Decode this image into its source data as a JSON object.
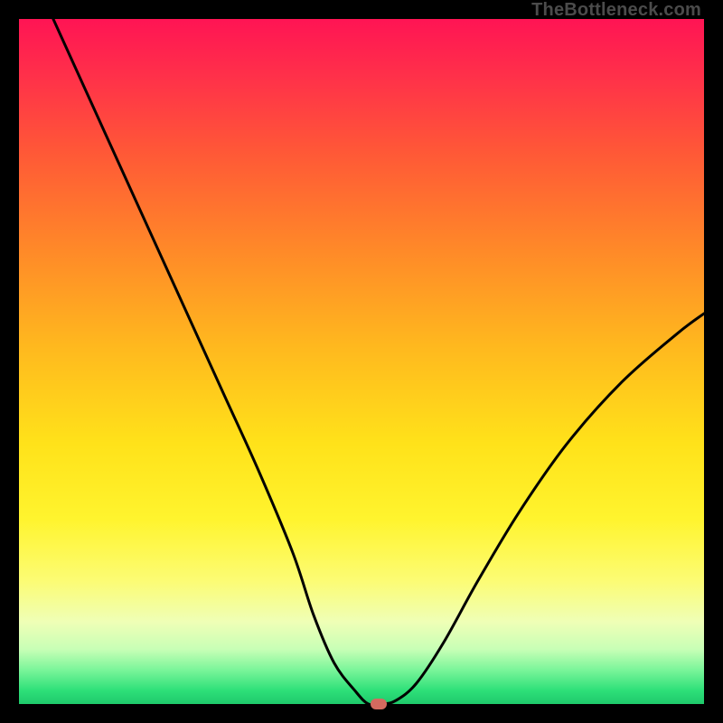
{
  "watermark": {
    "text": "TheBottleneck.com"
  },
  "chart_data": {
    "type": "line",
    "title": "",
    "xlabel": "",
    "ylabel": "",
    "xlim": [
      0,
      100
    ],
    "ylim": [
      0,
      100
    ],
    "grid": false,
    "legend": false,
    "series": [
      {
        "name": "bottleneck-curve",
        "x": [
          5,
          10,
          15,
          20,
          25,
          30,
          35,
          40,
          43,
          46,
          49,
          51,
          53,
          55,
          58,
          62,
          67,
          73,
          80,
          88,
          96,
          100
        ],
        "y": [
          100,
          89,
          78,
          67,
          56,
          45,
          34,
          22,
          13,
          6,
          2,
          0,
          0,
          0.5,
          3,
          9,
          18,
          28,
          38,
          47,
          54,
          57
        ]
      }
    ],
    "marker": {
      "x": 52.5,
      "y": 0,
      "color": "#d46a5f"
    },
    "background_gradient": {
      "top": "#ff1454",
      "mid": "#ffe21a",
      "bottom": "#1fc96b"
    }
  }
}
